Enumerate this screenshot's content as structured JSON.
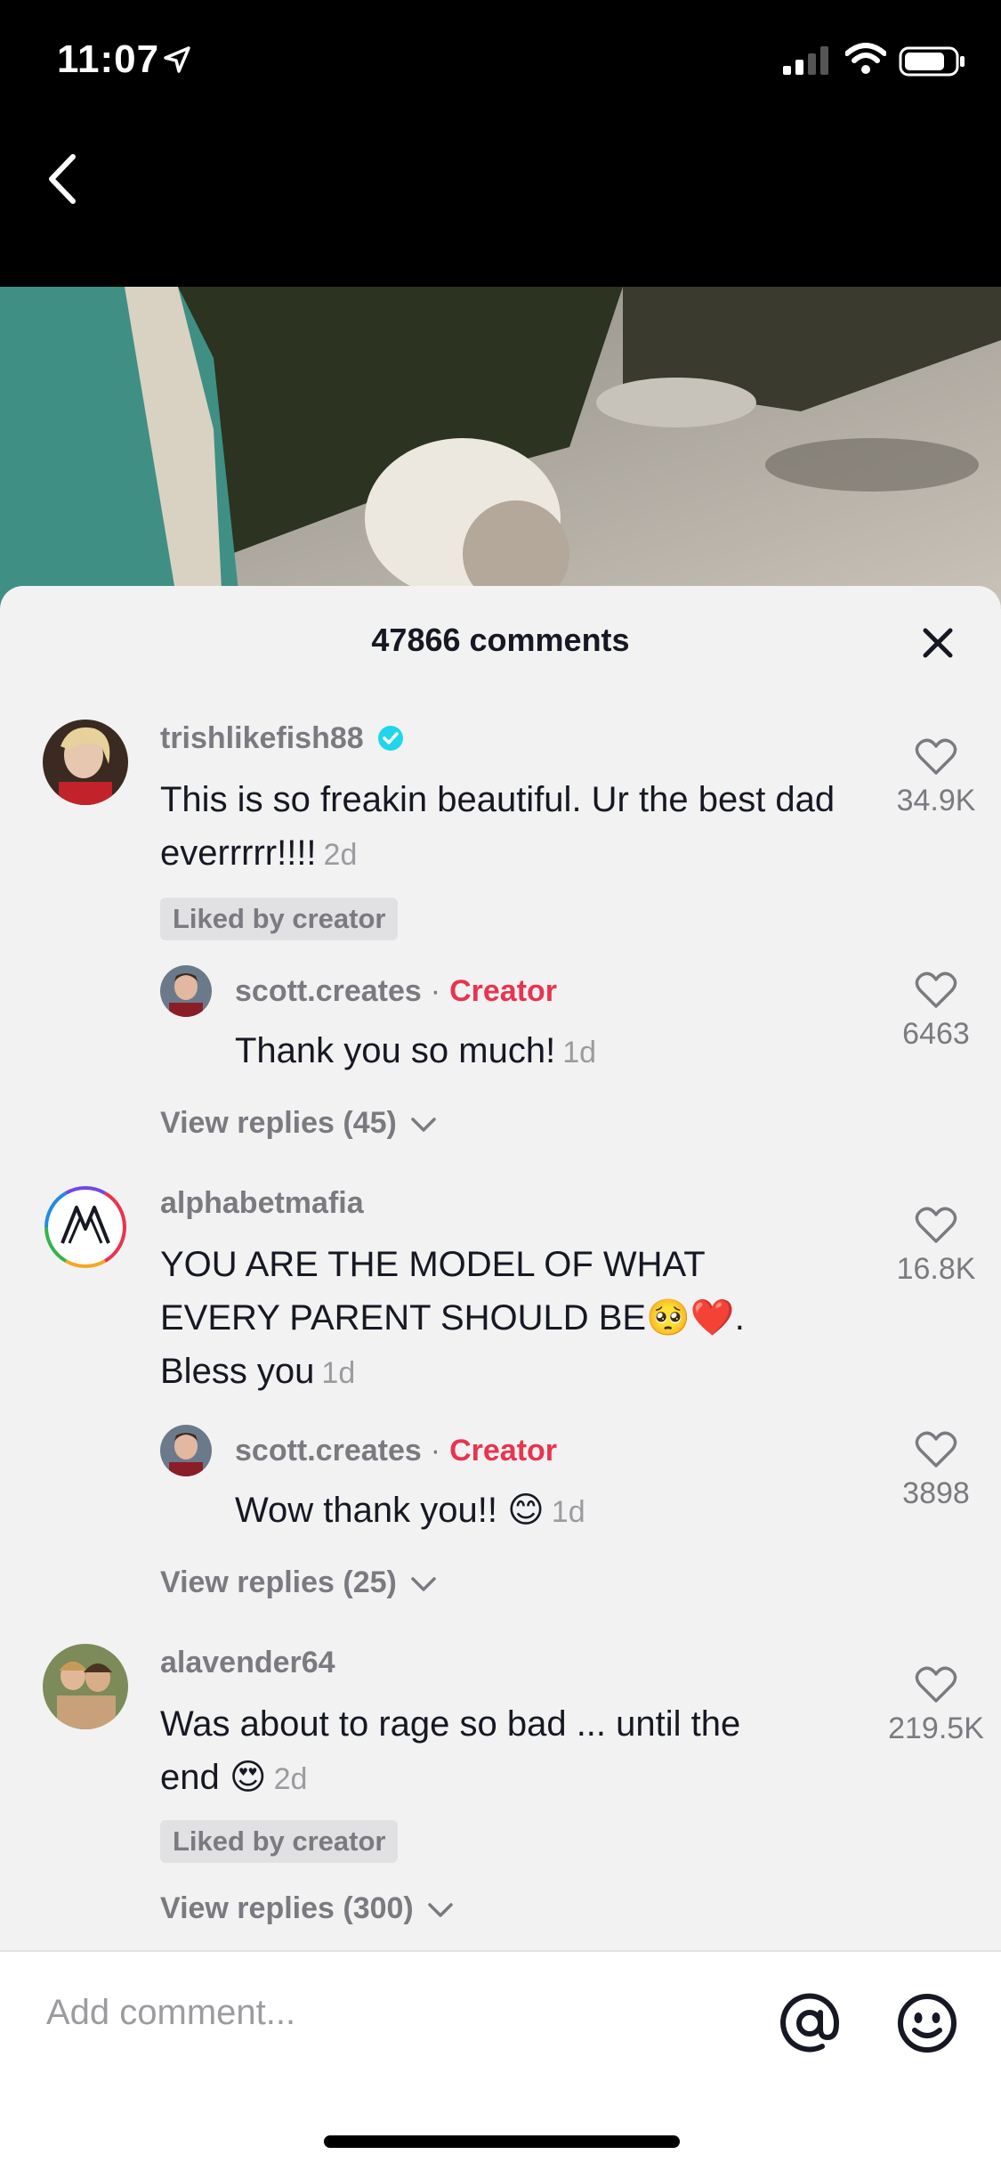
{
  "status": {
    "time": "11:07"
  },
  "sheet": {
    "title": "47866 comments",
    "comments": [
      {
        "username": "trishlikefish88",
        "verified": true,
        "text": "This is so freakin beautiful. Ur the best dad everrrrr!!!!",
        "age": "2d",
        "liked_badge": "Liked by creator",
        "likes": "34.9K",
        "reply": {
          "username": "scott.creates",
          "separator": "·",
          "creator_label": "Creator",
          "text": "Thank you so much!",
          "age": "1d",
          "likes": "6463"
        },
        "view_replies": "View replies (45)"
      },
      {
        "username": "alphabetmafia",
        "text_line1": "YOU ARE THE MODEL OF WHAT",
        "text_line2": "EVERY PARENT SHOULD BE🥺❤️.",
        "text_line3": "Bless you",
        "age": "1d",
        "likes": "16.8K",
        "reply": {
          "username": "scott.creates",
          "separator": "·",
          "creator_label": "Creator",
          "text": "Wow thank you!! 😊",
          "age": "1d",
          "likes": "3898"
        },
        "view_replies": "View replies (25)"
      },
      {
        "username": "alavender64",
        "text_line1": "Was about to rage so bad ... until the",
        "text_line2": "end 😍",
        "age": "2d",
        "liked_badge": "Liked by creator",
        "likes": "219.5K",
        "view_replies": "View replies (300)"
      }
    ]
  },
  "input": {
    "placeholder": "Add comment..."
  },
  "colors": {
    "creator": "#e8344f",
    "verified": "#20d5ec",
    "sheet_bg": "#f2f2f2"
  }
}
